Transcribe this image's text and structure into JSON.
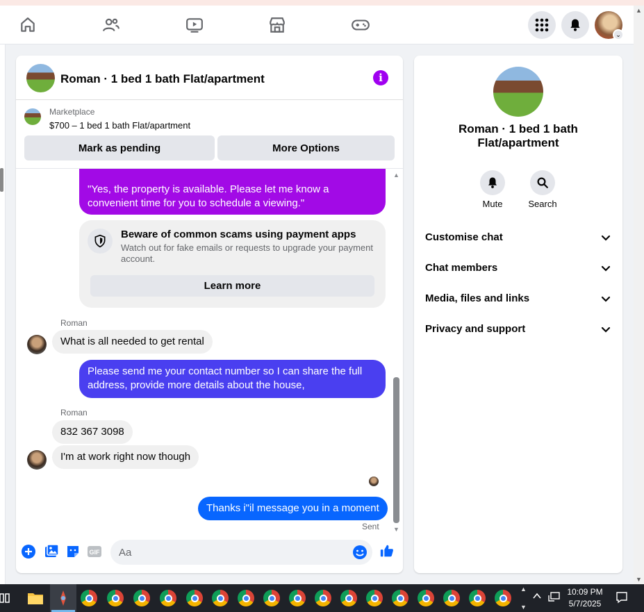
{
  "chat": {
    "title": "Roman · 1 bed 1 bath Flat/apartment",
    "marketplace_label": "Marketplace",
    "listing": "$700 – 1 bed 1 bath Flat/apartment",
    "mark_pending": "Mark as pending",
    "more_options": "More Options",
    "messages": {
      "out_1": "\"Yes, the property is available. Please let me know a convenient time for you to schedule a viewing.\"",
      "scam_title": "Beware of common scams using payment apps",
      "scam_body": "Watch out for fake emails or requests to upgrade your payment account.",
      "learn_more": "Learn more",
      "sender_1": "Roman",
      "in_1": "What is all needed to get rental",
      "out_2": "Please send me your contact number so I can share the full address, provide more details about the house,",
      "sender_2": "Roman",
      "in_2": "832 367 3098",
      "in_3": "I'm at work right now though",
      "out_3": "Thanks i\"il message you in a moment",
      "status": "Sent"
    },
    "composer_placeholder": "Aa"
  },
  "info": {
    "title": "Roman · 1 bed 1 bath Flat/apartment",
    "mute": "Mute",
    "search": "Search",
    "sections": [
      "Customise chat",
      "Chat members",
      "Media, files and links",
      "Privacy and support"
    ]
  },
  "taskbar": {
    "time": "10:09 PM",
    "date": "5/7/2025"
  },
  "colors": {
    "accent_purple": "#a20ae6",
    "bubble_blue": "#4a3ff0",
    "sent_blue": "#0866ff",
    "icon_blue": "#0866ff"
  }
}
